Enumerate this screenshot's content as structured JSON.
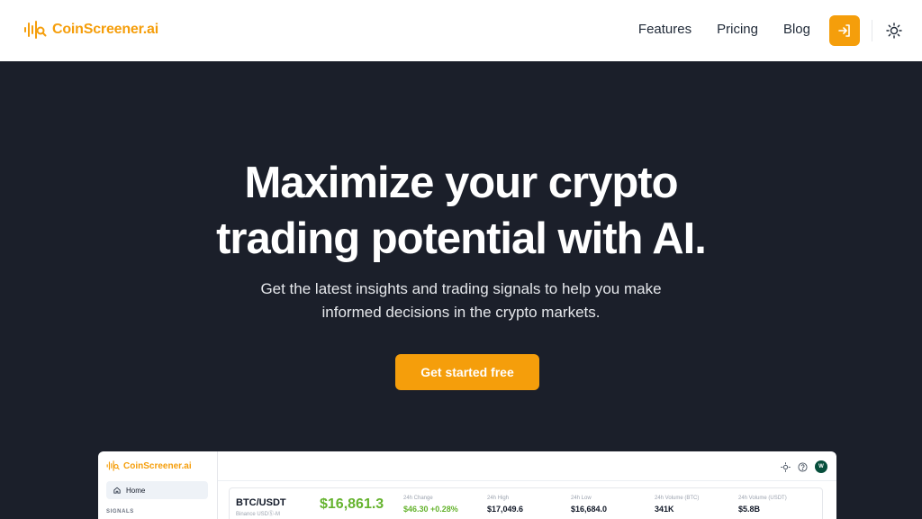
{
  "brand": {
    "name": "CoinScreener.ai",
    "color": "#f59e0b"
  },
  "nav": {
    "links": [
      "Features",
      "Pricing",
      "Blog"
    ],
    "signin_icon": "sign-in-icon",
    "theme_icon": "sun-icon"
  },
  "hero": {
    "title_line1": "Maximize your crypto",
    "title_line2": "trading potential with AI.",
    "subtitle_line1": "Get the latest insights and trading signals to help you make",
    "subtitle_line2": "informed decisions in the crypto markets.",
    "cta_label": "Get started free"
  },
  "preview": {
    "brand": "CoinScreener.ai",
    "home_label": "Home",
    "section_label": "SIGNALS",
    "avatar_initial": "W",
    "ticker": {
      "pair": "BTC/USDT",
      "exchange": "Binance USDⓈ-M",
      "price": "$16,861.3",
      "stats": [
        {
          "label": "24h Change",
          "value": "$46.30 +0.28%"
        },
        {
          "label": "24h High",
          "value": "$17,049.6"
        },
        {
          "label": "24h Low",
          "value": "$16,684.0"
        },
        {
          "label": "24h Volume (BTC)",
          "value": "341K"
        },
        {
          "label": "24h Volume (USDT)",
          "value": "$5.8B"
        }
      ]
    }
  },
  "colors": {
    "accent": "#f59e0b",
    "hero_bg": "#1b1f2a",
    "positive": "#65b32e"
  }
}
